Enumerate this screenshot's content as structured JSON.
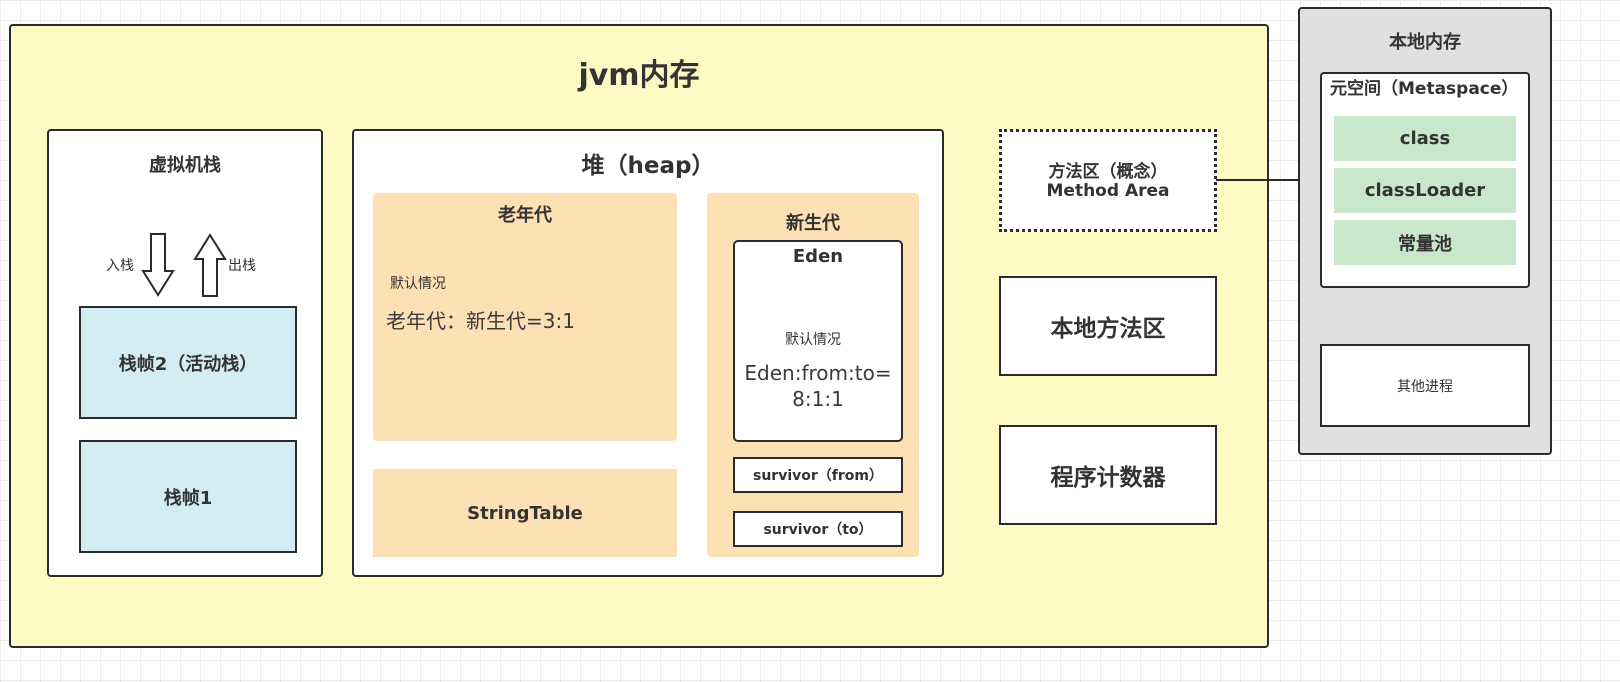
{
  "jvm": {
    "title": "jvm内存"
  },
  "stack": {
    "title": "虚拟机栈",
    "push_label": "入栈",
    "pop_label": "出栈",
    "frame2": "栈帧2（活动栈）",
    "frame1": "栈帧1"
  },
  "heap": {
    "title": "堆（heap）",
    "old_gen": {
      "title": "老年代",
      "default_label": "默认情况",
      "ratio": "老年代：新生代=3:1"
    },
    "string_table": "StringTable",
    "young_gen": {
      "title": "新生代",
      "eden": {
        "title": "Eden",
        "default_label": "默认情况",
        "ratio_line1": "Eden:from:to=",
        "ratio_line2": "8:1:1"
      },
      "survivor_from": "survivor（from）",
      "survivor_to": "survivor（to）"
    }
  },
  "method_area": {
    "line1": "方法区（概念）",
    "line2": "Method Area"
  },
  "native_method_area": "本地方法区",
  "program_counter": "程序计数器",
  "native_memory": {
    "title": "本地内存",
    "metaspace": {
      "title": "元空间（Metaspace）",
      "items": [
        "class",
        "classLoader",
        "常量池"
      ]
    },
    "other_process": "其他进程"
  },
  "colors": {
    "jvm_bg": "#fff9c4",
    "native_bg": "#e0e0e0",
    "frame_bg": "#d4ecf4",
    "generation_bg": "#fde0b3",
    "metaspace_item_bg": "#c9e7cb"
  }
}
